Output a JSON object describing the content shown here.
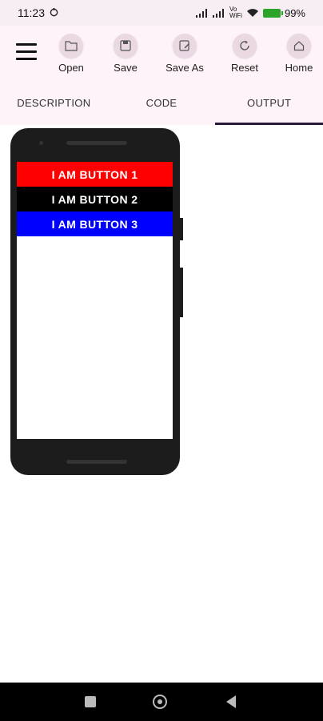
{
  "status_bar": {
    "time": "11:23",
    "battery": "99%"
  },
  "toolbar": {
    "menu_icon": "hamburger-menu-icon",
    "buttons": [
      {
        "label": "Open",
        "icon": "folder-open-icon"
      },
      {
        "label": "Save",
        "icon": "save-icon"
      },
      {
        "label": "Save As",
        "icon": "save-as-icon"
      },
      {
        "label": "Reset",
        "icon": "refresh-icon"
      },
      {
        "label": "Home",
        "icon": "home-icon"
      }
    ]
  },
  "tabs": [
    {
      "label": "DESCRIPTION",
      "active": false
    },
    {
      "label": "CODE",
      "active": false
    },
    {
      "label": "OUTPUT",
      "active": true
    }
  ],
  "preview": {
    "buttons": [
      {
        "label": "I AM BUTTON 1",
        "color": "#ff0000"
      },
      {
        "label": "I AM BUTTON 2",
        "color": "#000000"
      },
      {
        "label": "I AM BUTTON 3",
        "color": "#0000ff"
      }
    ]
  },
  "colors": {
    "toolbar_bg": "#fdf3f8",
    "active_tab_indicator": "#2a1a3a"
  }
}
